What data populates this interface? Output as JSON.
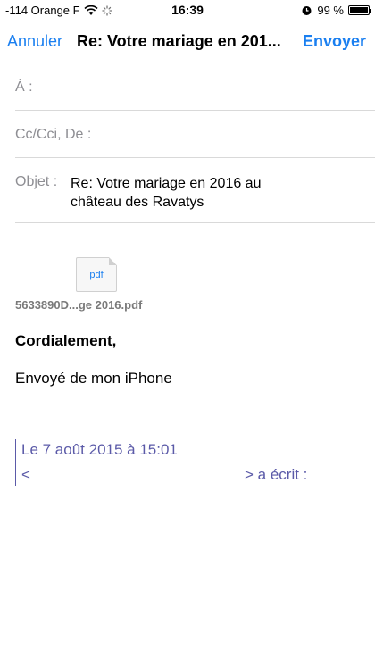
{
  "status_bar": {
    "carrier": "-114 Orange F",
    "time": "16:39",
    "battery": "99 %"
  },
  "nav": {
    "cancel": "Annuler",
    "title": "Re: Votre mariage en 201...",
    "send": "Envoyer"
  },
  "fields": {
    "to_label": "À :",
    "cc_label": "Cc/Cci, De :",
    "subject_label": "Objet :",
    "subject_value": "Re: Votre mariage en 2016 au château des Ravatys"
  },
  "attachment": {
    "icon_label": "pdf",
    "filename": "5633890D...ge 2016.pdf"
  },
  "body": {
    "closing": "Cordialement,",
    "signature": "Envoyé de mon iPhone"
  },
  "quote": {
    "date": "Le 7 août 2015 à 15:01",
    "open": "<",
    "wrote": "> a écrit :"
  },
  "colors": {
    "accent": "#1a7ff0",
    "quote": "#5b5aa8",
    "separator": "#d9d9d9",
    "label": "#8e8e93"
  }
}
